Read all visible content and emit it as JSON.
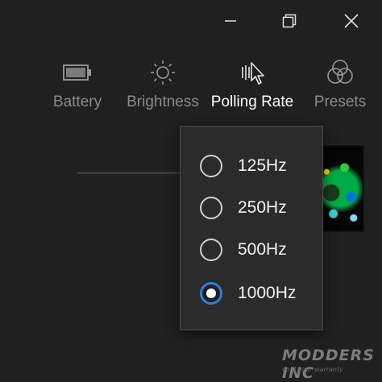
{
  "window_controls": {
    "minimize": "minimize-icon",
    "maximize": "restore-icon",
    "close": "close-icon"
  },
  "toolbar": {
    "items": [
      {
        "label": "Battery",
        "icon": "battery-icon",
        "active": false
      },
      {
        "label": "Brightness",
        "icon": "brightness-icon",
        "active": false
      },
      {
        "label": "Polling Rate",
        "icon": "pointer-icon",
        "active": true
      },
      {
        "label": "Presets",
        "icon": "presets-icon",
        "active": false
      }
    ]
  },
  "polling_menu": {
    "options": [
      {
        "label": "125Hz",
        "selected": false
      },
      {
        "label": "250Hz",
        "selected": false
      },
      {
        "label": "500Hz",
        "selected": false
      },
      {
        "label": "1000Hz",
        "selected": true
      }
    ],
    "selected_value": "1000Hz"
  },
  "colors": {
    "background": "#202020",
    "flyout_bg": "#2b2b2b",
    "accent": "#2f7fd9",
    "inactive_text": "#8a8a8a",
    "active_text": "#ffffff"
  },
  "watermark": {
    "title": "MODDERS INC",
    "subtitle": "void your warranty"
  }
}
